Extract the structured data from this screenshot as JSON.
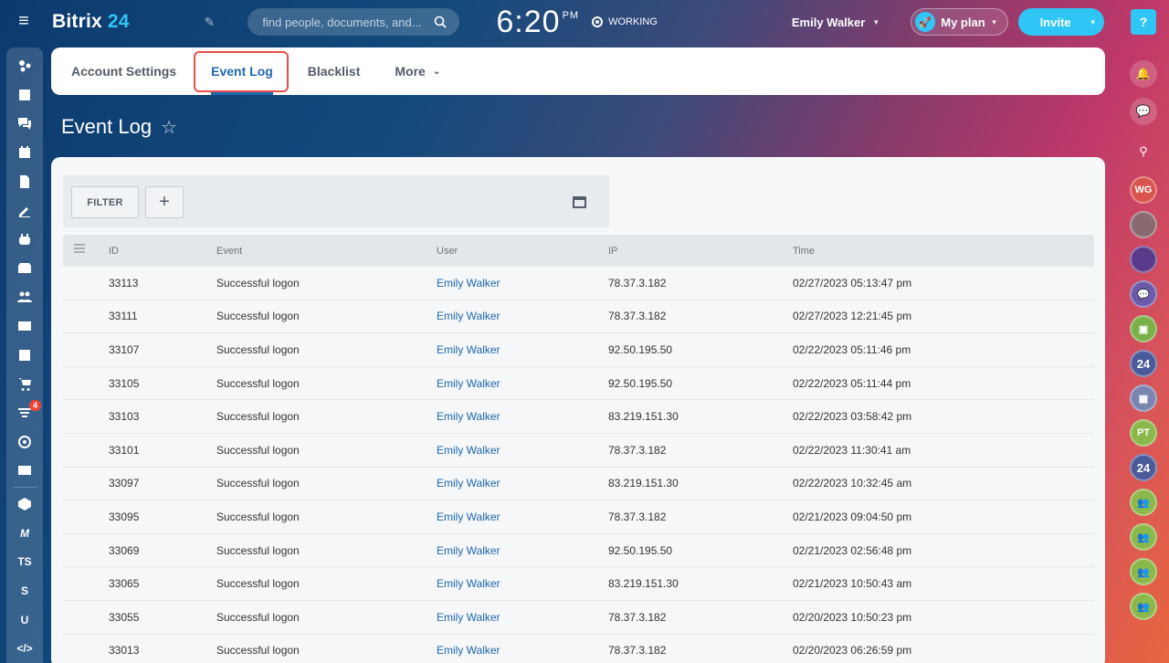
{
  "header": {
    "logo_name": "Bitrix",
    "logo_num": "24",
    "search_placeholder": "find people, documents, and...",
    "clock_time": "6:20",
    "clock_ampm": "PM",
    "work_status": "WORKING",
    "user_name": "Emily Walker",
    "plan_label": "My plan",
    "invite_label": "Invite"
  },
  "left_menu": {
    "badge_count": "4",
    "text_items": [
      "TS",
      "S",
      "U"
    ]
  },
  "right_bar": {
    "help_label": "?",
    "avatars": [
      "WG",
      "PT"
    ],
    "b24_label": "24"
  },
  "tabs": [
    {
      "label": "Account Settings"
    },
    {
      "label": "Event Log"
    },
    {
      "label": "Blacklist"
    },
    {
      "label": "More"
    }
  ],
  "page": {
    "title": "Event Log",
    "filter_label": "FILTER",
    "add_label": "+"
  },
  "table": {
    "columns": [
      "ID",
      "Event",
      "User",
      "IP",
      "Time"
    ],
    "rows": [
      {
        "id": "33113",
        "event": "Successful logon",
        "user": "Emily Walker",
        "ip": "78.37.3.182",
        "time": "02/27/2023 05:13:47 pm"
      },
      {
        "id": "33111",
        "event": "Successful logon",
        "user": "Emily Walker",
        "ip": "78.37.3.182",
        "time": "02/27/2023 12:21:45 pm"
      },
      {
        "id": "33107",
        "event": "Successful logon",
        "user": "Emily Walker",
        "ip": "92.50.195.50",
        "time": "02/22/2023 05:11:46 pm"
      },
      {
        "id": "33105",
        "event": "Successful logon",
        "user": "Emily Walker",
        "ip": "92.50.195.50",
        "time": "02/22/2023 05:11:44 pm"
      },
      {
        "id": "33103",
        "event": "Successful logon",
        "user": "Emily Walker",
        "ip": "83.219.151.30",
        "time": "02/22/2023 03:58:42 pm"
      },
      {
        "id": "33101",
        "event": "Successful logon",
        "user": "Emily Walker",
        "ip": "78.37.3.182",
        "time": "02/22/2023 11:30:41 am"
      },
      {
        "id": "33097",
        "event": "Successful logon",
        "user": "Emily Walker",
        "ip": "83.219.151.30",
        "time": "02/22/2023 10:32:45 am"
      },
      {
        "id": "33095",
        "event": "Successful logon",
        "user": "Emily Walker",
        "ip": "78.37.3.182",
        "time": "02/21/2023 09:04:50 pm"
      },
      {
        "id": "33069",
        "event": "Successful logon",
        "user": "Emily Walker",
        "ip": "92.50.195.50",
        "time": "02/21/2023 02:56:48 pm"
      },
      {
        "id": "33065",
        "event": "Successful logon",
        "user": "Emily Walker",
        "ip": "83.219.151.30",
        "time": "02/21/2023 10:50:43 am"
      },
      {
        "id": "33055",
        "event": "Successful logon",
        "user": "Emily Walker",
        "ip": "78.37.3.182",
        "time": "02/20/2023 10:50:23 pm"
      },
      {
        "id": "33013",
        "event": "Successful logon",
        "user": "Emily Walker",
        "ip": "78.37.3.182",
        "time": "02/20/2023 06:26:59 pm"
      }
    ]
  },
  "colors": {
    "accent": "#2fc6f6",
    "link": "#2067b0",
    "highlight_frame": "#e8504a"
  }
}
